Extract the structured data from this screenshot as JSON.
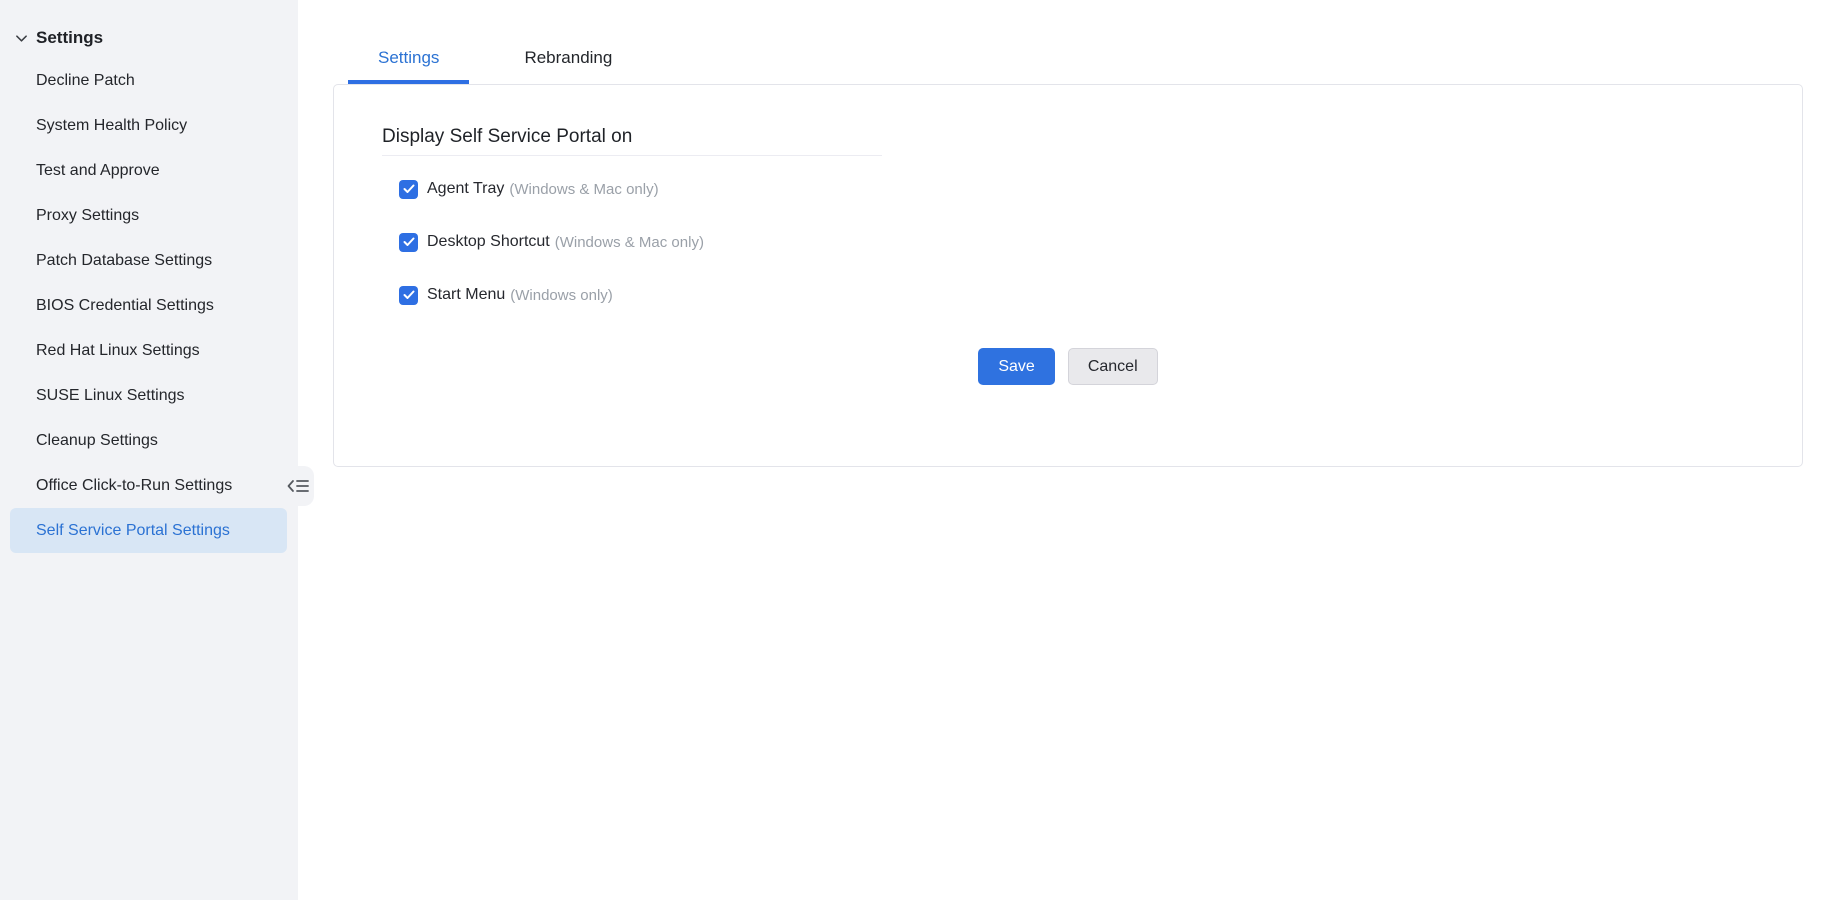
{
  "colors": {
    "accent_blue": "#2e6fe3",
    "link_blue": "#2b72d3",
    "selected_item_bg": "#d8e6f5",
    "sidebar_bg": "#f2f3f6",
    "muted_text": "#9aa0a8",
    "panel_border": "#e3e4ea"
  },
  "sidebar": {
    "header": {
      "label": "Settings"
    },
    "items": [
      {
        "label": "Decline Patch",
        "selected": false
      },
      {
        "label": "System Health Policy",
        "selected": false
      },
      {
        "label": "Test and Approve",
        "selected": false
      },
      {
        "label": "Proxy Settings",
        "selected": false
      },
      {
        "label": "Patch Database Settings",
        "selected": false
      },
      {
        "label": "BIOS Credential Settings",
        "selected": false
      },
      {
        "label": "Red Hat Linux Settings",
        "selected": false
      },
      {
        "label": "SUSE Linux Settings",
        "selected": false
      },
      {
        "label": "Cleanup Settings",
        "selected": false
      },
      {
        "label": "Office Click-to-Run Settings",
        "selected": false
      },
      {
        "label": "Self Service Portal Settings",
        "selected": true
      }
    ]
  },
  "main": {
    "tabs": [
      {
        "label": "Settings",
        "active": true
      },
      {
        "label": "Rebranding",
        "active": false
      }
    ],
    "panel": {
      "heading": "Display Self Service Portal on",
      "checkboxes": [
        {
          "label": "Agent Tray",
          "note": "(Windows & Mac only)",
          "checked": true
        },
        {
          "label": "Desktop Shortcut",
          "note": "(Windows & Mac only)",
          "checked": true
        },
        {
          "label": "Start Menu",
          "note": "(Windows only)",
          "checked": true
        }
      ],
      "buttons": {
        "save": "Save",
        "cancel": "Cancel"
      }
    }
  },
  "icons": {
    "sidebar_header": "chevron-down-icon",
    "collapse": "collapse-sidebar-icon",
    "checkbox": "check-icon"
  }
}
